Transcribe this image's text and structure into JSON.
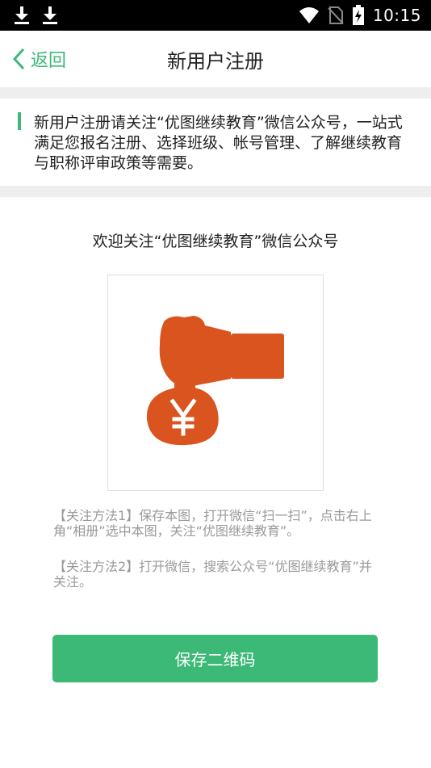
{
  "status_bar": {
    "time": "10:15",
    "icons": [
      "download-icon",
      "download-icon",
      "wifi-icon",
      "no-sim-icon",
      "battery-charging-icon"
    ]
  },
  "nav": {
    "back_label": "返回",
    "title": "新用户注册"
  },
  "notice": {
    "text": "新用户注册请关注“优图继续教育”微信公众号，一站式满足您报名注册、选择班级、帐号管理、了解继续教育与职称评审政策等需要。"
  },
  "main": {
    "welcome": "欢迎关注“优图继续教育”微信公众号",
    "method1": "【关注方法1】保存本图，打开微信“扫一扫”，点击右上角“相册”选中本图，关注“优图继续教育”。",
    "method2": "【关注方法2】打开微信，搜索公众号“优图继续教育”并关注。",
    "save_button": "保存二维码"
  },
  "colors": {
    "accent": "#3cb877",
    "image_orange": "#d9541e"
  }
}
